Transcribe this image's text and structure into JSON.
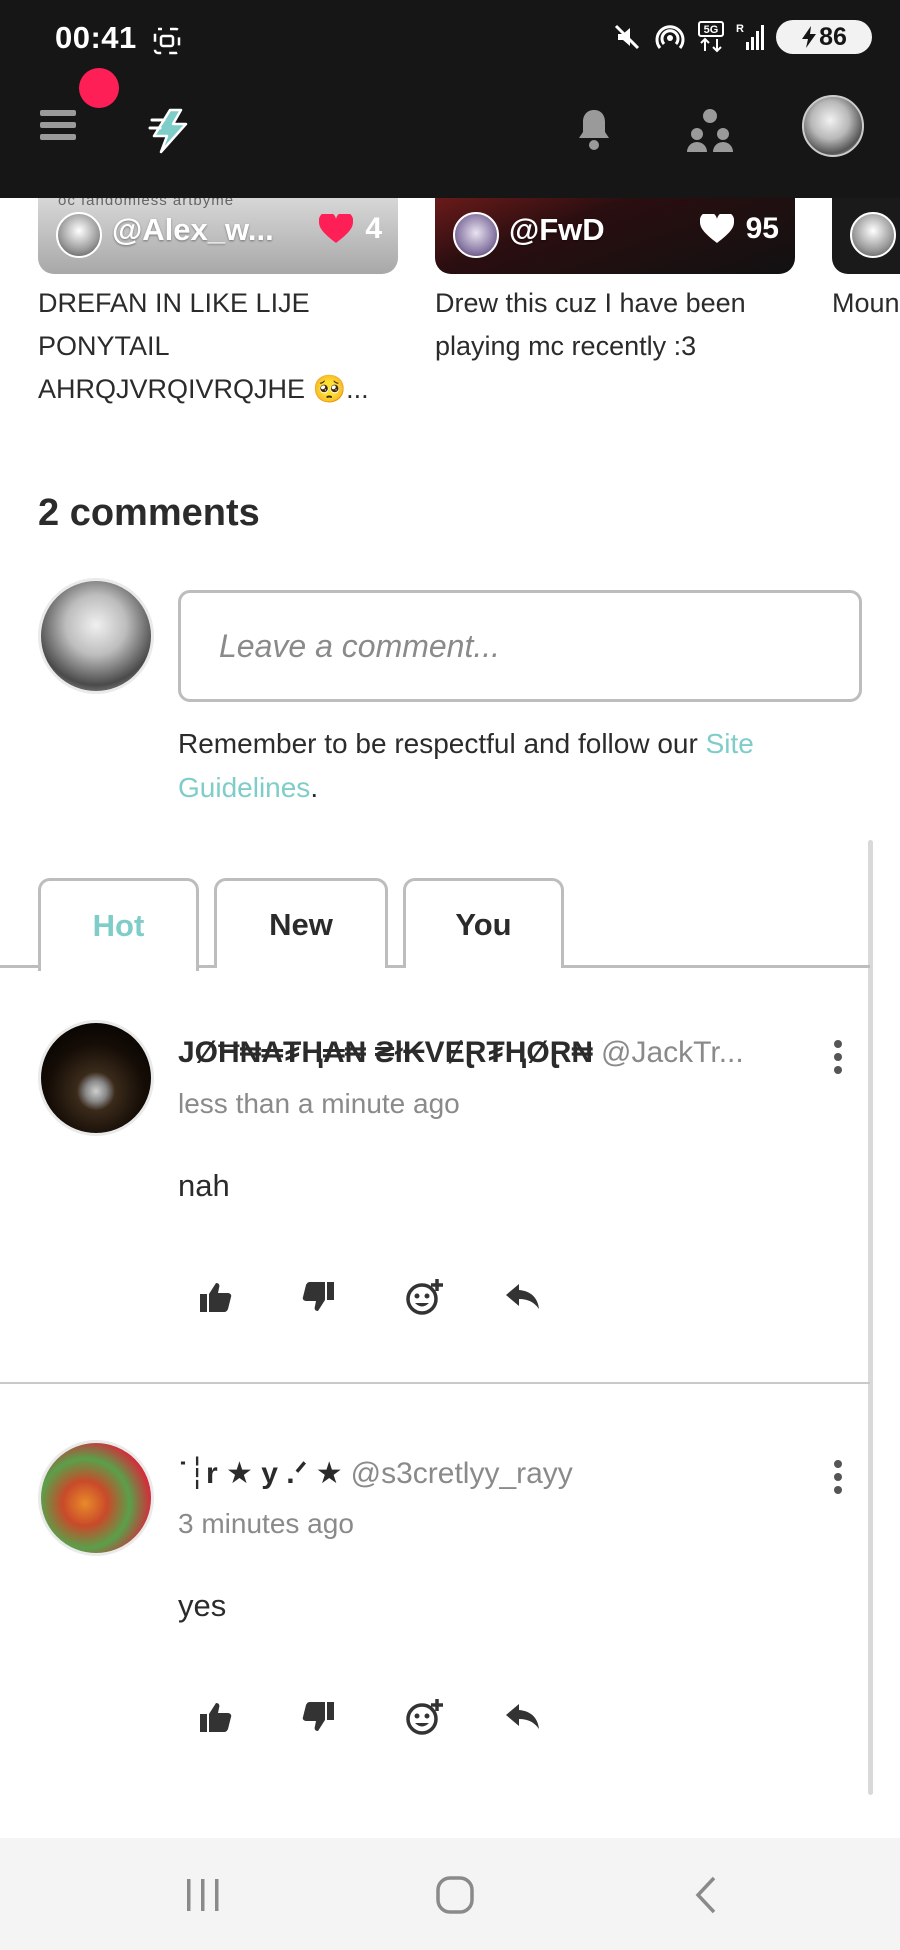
{
  "status_bar": {
    "time": "00:41",
    "battery": "86",
    "network": "5G",
    "icons": [
      "screenshot-icon",
      "mute-icon",
      "hotspot-icon",
      "data-arrows-icon",
      "signal-icon",
      "battery-charging-icon"
    ]
  },
  "app_bar": {
    "icons": [
      "menu-icon",
      "logo-icon",
      "bell-icon",
      "people-icon",
      "avatar"
    ],
    "notification_dot_color": "#ff1f57"
  },
  "cards": [
    {
      "user": "@Alex_w...",
      "likes": "4",
      "title": "DREFAN IN LIKE LIJE PONYTAIL AHRQJVRQIVRQJHE 🥺...",
      "thumb_text": "oc   fandomless   artbyme"
    },
    {
      "user": "@FwD",
      "likes": "95",
      "title": "Drew this cuz I have been playing mc recently :3"
    },
    {
      "title": "Moun"
    }
  ],
  "comments_section": {
    "count_label": "2 comments",
    "input_placeholder": "Leave a comment...",
    "guideline_prefix": "Remember to be respectful and follow our ",
    "guideline_link": "Site Guidelines",
    "guideline_suffix": ".",
    "accent_color": "#7fcdc9"
  },
  "tabs": [
    {
      "label": "Hot",
      "active": true
    },
    {
      "label": "New",
      "active": false
    },
    {
      "label": "You",
      "active": false
    }
  ],
  "comments": [
    {
      "name": "JØĦ₦₳₮Ⱨ₳₦ ₴ł₭VɆⱤ₮ⱧØⱤ₦",
      "handle": "@JackTr...",
      "time": "less than a minute ago",
      "text": "nah"
    },
    {
      "name": "˙┆r ★ y .ᐟ ★",
      "handle": "@s3cretlyy_rayy",
      "time": "3 minutes ago",
      "text": "yes"
    }
  ],
  "nav_bar": {
    "icons": [
      "recent-apps-icon",
      "home-icon",
      "back-icon"
    ]
  }
}
